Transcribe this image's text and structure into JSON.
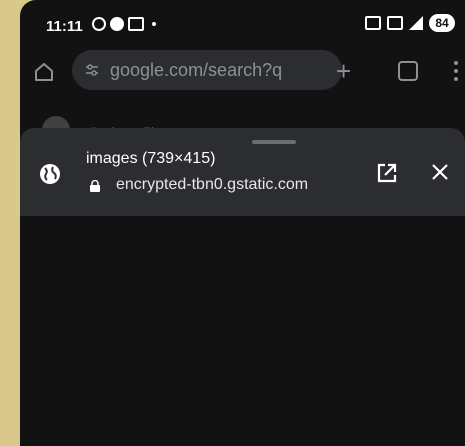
{
  "status_bar": {
    "time": "11:11",
    "battery": "84"
  },
  "toolbar": {
    "url": "google.com/search?q"
  },
  "background_result": {
    "text": "Graham Fiora"
  },
  "preview_sheet": {
    "title": "images (739×415)",
    "url": "encrypted-tbn0.gstatic.com"
  },
  "colors": {
    "background": "#121212",
    "sheet_header": "#2c2d30",
    "url_bar": "#2b2d31",
    "muted_text": "#8d9096"
  }
}
